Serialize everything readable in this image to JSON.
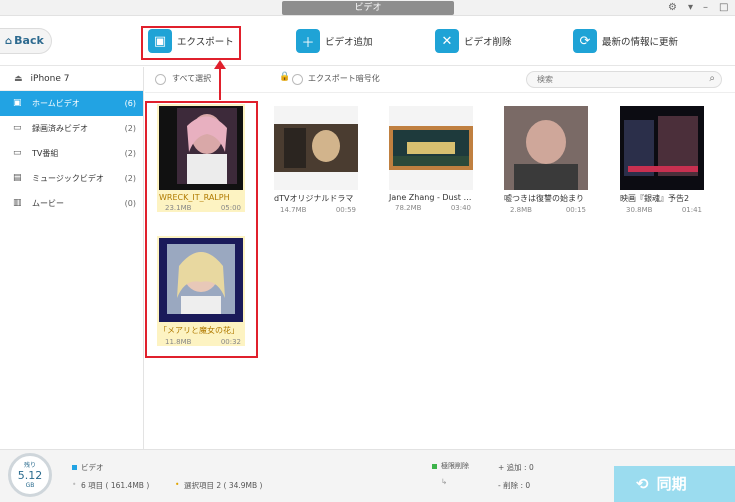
{
  "window": {
    "title": "ビデオ",
    "settings_icon": "gear-icon"
  },
  "toolbar": {
    "back_label": "Back",
    "export_label": "エクスポート",
    "add_label": "ビデオ追加",
    "delete_label": "ビデオ削除",
    "refresh_label": "最新の情報に更新"
  },
  "sidebar": {
    "device": "iPhone 7",
    "items": [
      {
        "label": "ホームビデオ",
        "count": "(6)",
        "icon": "video-folder-icon"
      },
      {
        "label": "録画済みビデオ",
        "count": "(2)",
        "icon": "recorded-video-icon"
      },
      {
        "label": "TV番組",
        "count": "(2)",
        "icon": "tv-icon"
      },
      {
        "label": "ミュージックビデオ",
        "count": "(2)",
        "icon": "music-video-icon"
      },
      {
        "label": "ムービー",
        "count": "(0)",
        "icon": "film-icon"
      }
    ]
  },
  "filter": {
    "select_all": "すべて選択",
    "encrypt_export": "エクスポート暗号化",
    "search_placeholder": "検索"
  },
  "videos": [
    {
      "name": "WRECK_IT_RALPH",
      "size": "23.1MB",
      "duration": "05:00",
      "selected": true
    },
    {
      "name": "dTVオリジナルドラマ",
      "size": "14.7MB",
      "duration": "00:59",
      "selected": false
    },
    {
      "name": "Jane Zhang - Dust My Shoulders Off",
      "size": "78.2MB",
      "duration": "03:40",
      "selected": false
    },
    {
      "name": "嘘つきは復讐の始まり",
      "size": "2.8MB",
      "duration": "00:15",
      "selected": false
    },
    {
      "name": "映画『銀魂』予告2",
      "size": "30.8MB",
      "duration": "01:41",
      "selected": false
    },
    {
      "name": "「メアリと魔女の花」",
      "size": "11.8MB",
      "duration": "00:32",
      "selected": true
    }
  ],
  "status": {
    "storage_label": "残り",
    "storage_value": "5.12",
    "storage_unit": "GB",
    "category": "ビデオ",
    "total_items": "6 項目 ( 161.4MB )",
    "selected_items": "選択項目 2 ( 34.9MB )",
    "limit_delete": "極限削除",
    "added": "+ 追加 : 0",
    "removed": "- 削除 : 0",
    "sync_label": "同期"
  },
  "colors": {
    "accent": "#22a3e3",
    "highlight": "#e0202c",
    "selected_tile": "#fdf3c2"
  }
}
